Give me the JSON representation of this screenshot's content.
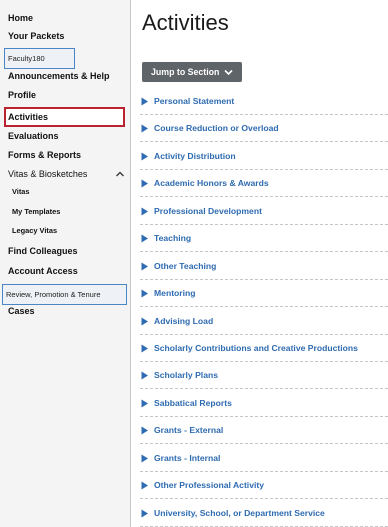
{
  "sidebar": {
    "top_items": [
      "Home",
      "Your Packets"
    ],
    "faculty_section": "Faculty180",
    "faculty_items": [
      "Announcements & Help",
      "Profile",
      "Activities",
      "Evaluations",
      "Forms & Reports",
      "Vitas & Biosketches"
    ],
    "vitas_sub_items": [
      "Vitas",
      "My Templates",
      "Legacy Vitas"
    ],
    "more_items": [
      "Find Colleagues",
      "Account Access"
    ],
    "rpt_section": "Review, Promotion & Tenure",
    "rpt_items": [
      "Cases"
    ],
    "active_item": "Activities"
  },
  "main": {
    "title": "Activities",
    "jump_button": "Jump to Section",
    "sections": [
      "Personal Statement",
      "Course Reduction or Overload",
      "Activity Distribution",
      "Academic Honors & Awards",
      "Professional Development",
      "Teaching",
      "Other Teaching",
      "Mentoring",
      "Advising Load",
      "Scholarly Contributions and Creative Productions",
      "Scholarly Plans",
      "Sabbatical Reports",
      "Grants - External",
      "Grants - Internal",
      "Other Professional Activity",
      "University, School, or Department Service"
    ]
  },
  "icons": {
    "section_toggle": "caret-right-icon",
    "jump_chevron": "chevron-down-icon",
    "collapse_chevron": "chevron-up-icon"
  },
  "colors": {
    "link": "#2e6bb0",
    "active_border": "#b8232f",
    "section_border": "#4a86c5",
    "button_bg": "#5f6468"
  }
}
